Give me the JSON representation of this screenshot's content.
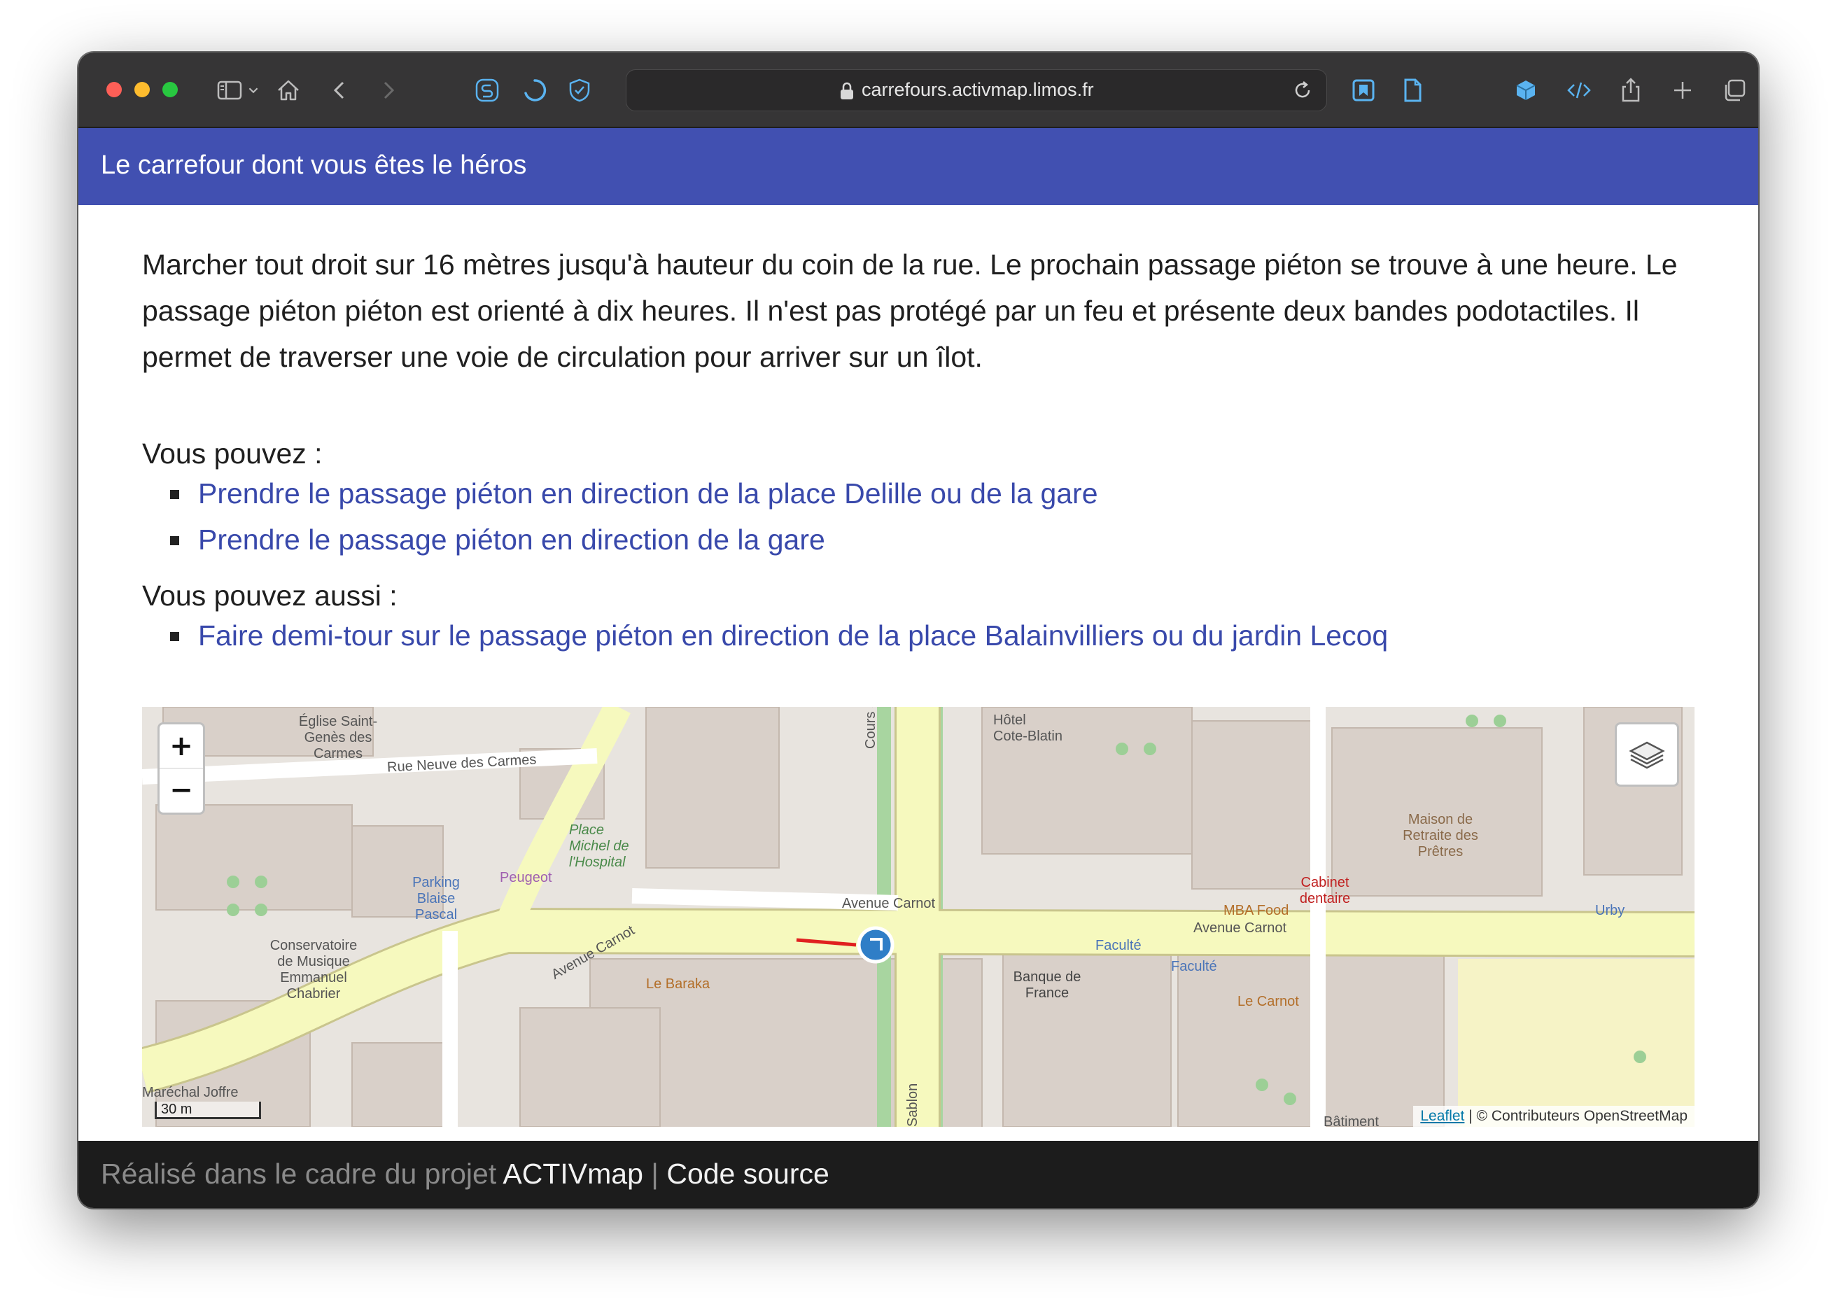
{
  "browser": {
    "url": "carrefours.activmap.limos.fr"
  },
  "app": {
    "title": "Le carrefour dont vous êtes le héros"
  },
  "instruction": "Marcher tout droit sur 16 mètres jusqu'à hauteur du coin de la rue. Le prochain passage piéton se trouve à une heure. Le passage piéton piéton est orienté à dix heures. Il n'est pas protégé par un feu et présente deux bandes podotactiles. Il permet de traverser une voie de circulation pour arriver sur un îlot.",
  "choices": {
    "label": "Vous pouvez :",
    "items": [
      {
        "text": "Prendre le passage piéton en direction de la place Delille ou de la gare"
      },
      {
        "text": "Prendre le passage piéton en direction de la gare"
      }
    ]
  },
  "alternatives": {
    "label": "Vous pouvez aussi :",
    "items": [
      {
        "text": "Faire demi-tour sur le passage piéton en direction de la place Balainvilliers ou du jardin Lecoq"
      }
    ]
  },
  "map": {
    "zoom_in": "+",
    "zoom_out": "−",
    "scale": "30 m",
    "attribution_link": "Leaflet",
    "attribution_text": "| © Contributeurs OpenStreetMap",
    "labels": {
      "avenue_carnot_1": "Avenue Carnot",
      "avenue_carnot_2": "Avenue Carnot",
      "avenue_carnot_3": "Avenue Carnot",
      "rue_neuve": "Rue Neuve des Carmes",
      "cours_sablon": "Cours Sablon",
      "sablon": "Sablon",
      "eglise": "Église Saint-Genès des Carmes",
      "parking": "Parking Blaise Pascal",
      "peugeot": "Peugeot",
      "place_michel": "Place Michel de l'Hospital",
      "conservatoire": "Conservatoire de Musique Emmanuel Chabrier",
      "baraka": "Le Baraka",
      "banque": "Banque de France",
      "hotel": "Hôtel Cote-Blatin",
      "maison": "Maison de Retraite des Prêtres",
      "cabinet": "Cabinet dentaire",
      "mba": "MBA Food",
      "faculte1": "Faculté",
      "faculte2": "Faculté",
      "carnot_bar": "Le Carnot",
      "urby": "Urby",
      "marechal": "Maréchal Joffre",
      "batiment": "Bâtiment"
    }
  },
  "footer": {
    "prefix": "Réalisé dans le cadre du projet",
    "project_link": "ACTIVmap",
    "separator": "|",
    "source_link": "Code source"
  },
  "colors": {
    "appbar": "#4150b1",
    "link": "#3949ab",
    "footer": "#1c1c1c",
    "road_main": "#f6f9be"
  }
}
